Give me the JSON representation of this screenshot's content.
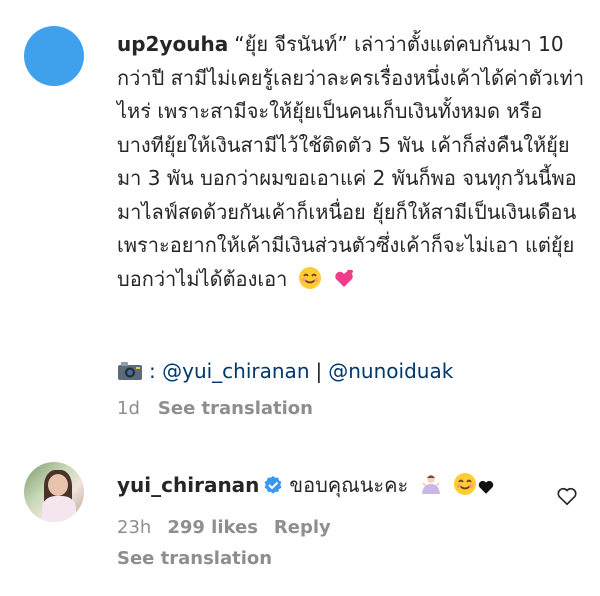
{
  "comment1": {
    "username": "up2youha",
    "text": "“ยุ้ย จีรนันท์” เล่าว่าตั้งแต่คบกันมา 10 กว่าปี สามีไม่เคยรู้เลยว่าละครเรื่องหนึ่งเค้าได้ค่าตัวเท่าไหร่ เพราะสามีจะให้ยุ้ยเป็นคนเก็บเงินทั้งหมด หรือบางทียุ้ยให้เงินสามีไว้ใช้ติดตัว 5 พัน เค้าก็ส่งคืนให้ยุ้ยมา 3 พัน บอกว่าผมขอเอาแค่ 2 พันก็พอ จนทุกวันนี้พอมาไลฟ์สดด้วยกันเค้าก็เหนื่อย ยุ้ยก็ให้สามีเป็นเงินเดือนเพราะอยากให้เค้ามีเงินส่วนตัวซึ่งเค้าก็จะไม่เอา แต่ยุ้ยบอกว่าไม่ได้ต้องเอา",
    "camera_prefix": ":",
    "tag1": "@yui_chiranan",
    "separator": "|",
    "tag2": "@nunoiduak",
    "time": "1d",
    "see_translation": "See translation"
  },
  "comment2": {
    "username": "yui_chiranan",
    "text": "ขอบคุณนะคะ",
    "time": "23h",
    "likes": "299 likes",
    "reply": "Reply",
    "see_translation": "See translation"
  },
  "colors": {
    "avatar_blue": "#3fa1ec",
    "verified_blue": "#3897f0",
    "link_blue": "#00376b",
    "muted_gray": "#8e8e8e"
  },
  "icons": [
    "camera-emoji",
    "smile-emoji",
    "two-hearts-emoji",
    "verified-badge",
    "shrug-emoji",
    "black-heart-emoji",
    "like-heart-icon"
  ]
}
